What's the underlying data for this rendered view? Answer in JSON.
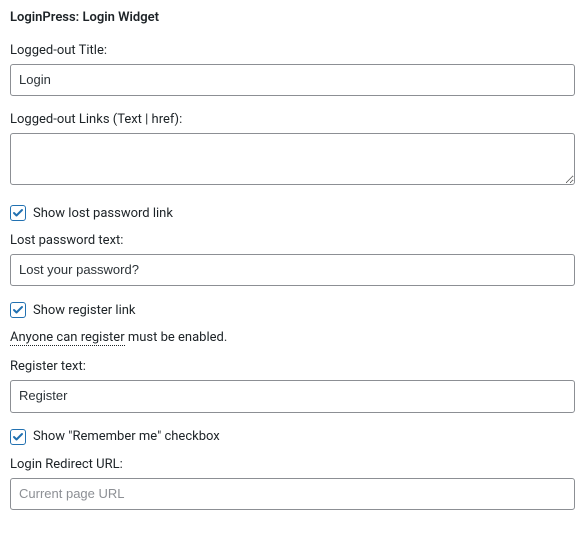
{
  "header": {
    "title": "LoginPress: Login Widget"
  },
  "loggedOutTitle": {
    "label": "Logged-out Title:",
    "value": "Login"
  },
  "loggedOutLinks": {
    "label": "Logged-out Links (Text | href):",
    "value": ""
  },
  "showLostPassword": {
    "label": "Show lost password link",
    "checked": true
  },
  "lostPasswordText": {
    "label": "Lost password text:",
    "value": "Lost your password?"
  },
  "showRegisterLink": {
    "label": "Show register link",
    "checked": true
  },
  "registerHelper": {
    "linkText": "Anyone can register",
    "suffix": " must be enabled."
  },
  "registerText": {
    "label": "Register text:",
    "value": "Register"
  },
  "showRememberMe": {
    "label": "Show \"Remember me\" checkbox",
    "checked": true
  },
  "loginRedirect": {
    "label": "Login Redirect URL:",
    "placeholder": "Current page URL",
    "value": ""
  }
}
